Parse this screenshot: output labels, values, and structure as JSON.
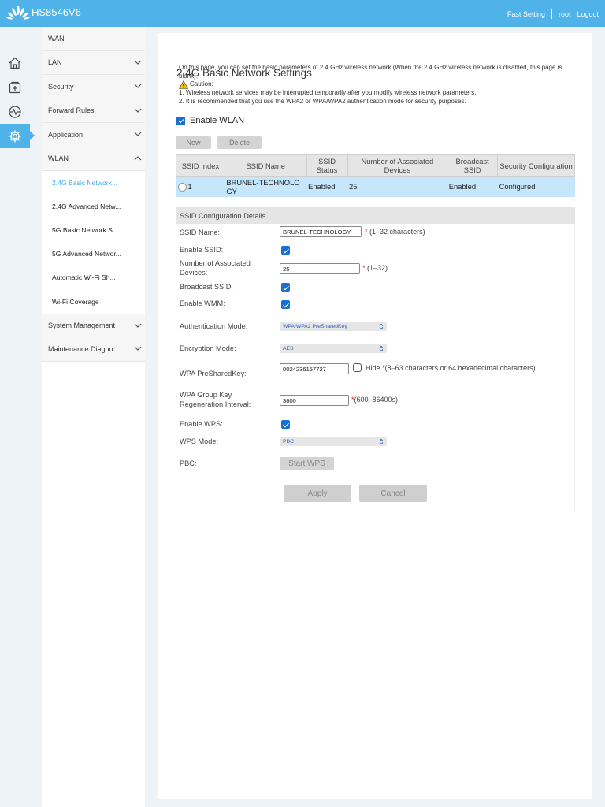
{
  "header": {
    "brand": "HS8546V6",
    "links": {
      "fast_setting": "Fast Setting",
      "user": "root",
      "logout": "Logout"
    }
  },
  "colors": {
    "accent": "#4fb3ea",
    "active_link": "#3fa9f0",
    "row_selected": "#c6e6fb",
    "checkbox": "#1a6fd1"
  },
  "rail": [
    "home-icon",
    "add-box-icon",
    "monitor-icon",
    "gear-icon"
  ],
  "menu": {
    "items": [
      {
        "label": "WAN"
      },
      {
        "label": "LAN"
      },
      {
        "label": "Security"
      },
      {
        "label": "Forward Rules"
      },
      {
        "label": "Application"
      },
      {
        "label": "WLAN"
      }
    ],
    "wlan_sub": [
      {
        "label": "2.4G Basic Network..."
      },
      {
        "label": "2.4G Advanced Netw..."
      },
      {
        "label": "5G Basic Network S..."
      },
      {
        "label": "5G Advanced Networ..."
      },
      {
        "label": "Automatic Wi-Fi Sh..."
      },
      {
        "label": "Wi-Fi Coverage"
      }
    ],
    "bottom": [
      {
        "label": "System Management"
      },
      {
        "label": "Maintenance Diagno..."
      }
    ]
  },
  "page": {
    "title": "2.4G Basic Network Settings",
    "desc_line1": "On this page, you can set the basic parameters of 2.4 GHz wireless network (When the 2.4 GHz wireless network is disabled, this page is blank).",
    "caution": "Caution:",
    "note1": "1. Wireless network services may be interrupted temporarily after you modify wireless network parameters.",
    "note2": "2. It is recommended that you use the WPA2 or WPA/WPA2 authentication mode for security purposes.",
    "enable_wlan": "Enable WLAN",
    "btn_new": "New",
    "btn_delete": "Delete"
  },
  "ssid_table": {
    "headers": [
      "SSID Index",
      "SSID Name",
      "SSID Status",
      "Number of Associated Devices",
      "Broadcast SSID",
      "Security Configuration"
    ],
    "row": {
      "index": "1",
      "name": "BRUNEL-TECHNOLOGY",
      "status": "Enabled",
      "devices": "25",
      "broadcast": "Enabled",
      "security": "Configured"
    }
  },
  "config": {
    "heading": "SSID Configuration Details",
    "ssid_name_label": "SSID Name:",
    "ssid_name_value": "BRUNEL-TECHNOLOGY",
    "ssid_name_hint": "(1–32 characters)",
    "enable_ssid_label": "Enable SSID:",
    "assoc_label": "Number of Associated Devices:",
    "assoc_value": "25",
    "assoc_hint": "(1–32)",
    "broadcast_label": "Broadcast SSID:",
    "wmm_label": "Enable WMM:",
    "auth_label": "Authentication Mode:",
    "auth_value": "WPA/WPA2 PreSharedKey",
    "enc_label": "Encryption Mode:",
    "enc_value": "AES",
    "psk_label": "WPA PreSharedKey:",
    "psk_value": "0024236157727",
    "hide_label": "Hide",
    "psk_hint": "(8–63 characters or 64 hexadecimal characters)",
    "group_label": "WPA Group Key Regeneration Interval:",
    "group_value": "3600",
    "group_hint": "(600–86400s)",
    "wps_label": "Enable WPS:",
    "wps_mode_label": "WPS Mode:",
    "wps_mode_value": "PBC",
    "pbc_label": "PBC:",
    "start_wps": "Start WPS",
    "apply": "Apply",
    "cancel": "Cancel"
  }
}
